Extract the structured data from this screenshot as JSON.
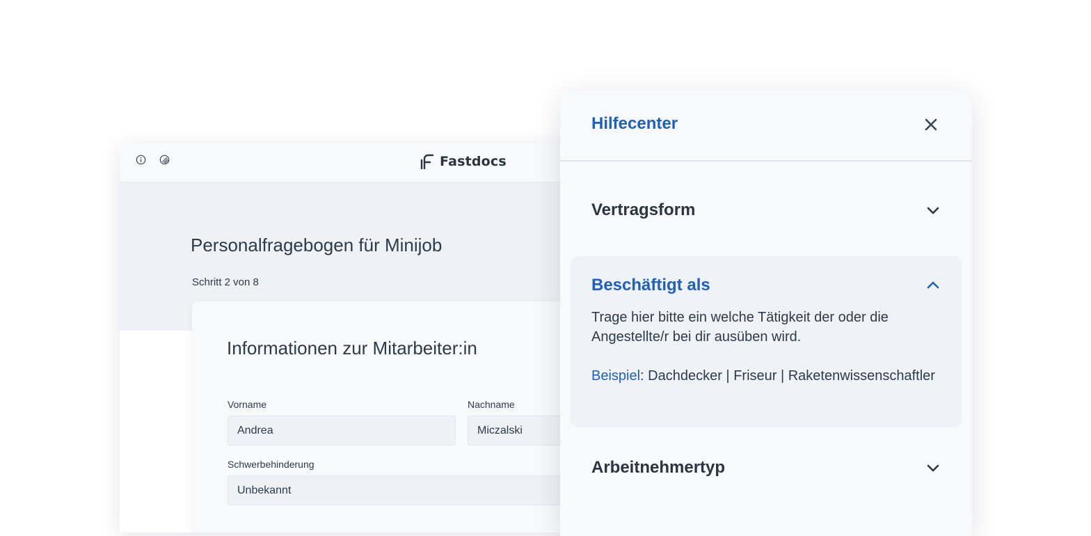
{
  "app": {
    "brand": "Fastdocs",
    "topbar_icons": [
      "info-icon",
      "theme-icon"
    ]
  },
  "form": {
    "page_title": "Personalfragebogen für Minijob",
    "step": "Schritt 2 von 8",
    "section_title": "Informationen zur Mitarbeiter:in",
    "fields": {
      "firstname": {
        "label": "Vorname",
        "value": "Andrea"
      },
      "lastname": {
        "label": "Nachname",
        "value": "Miczalski"
      },
      "disability": {
        "label": "Schwerbehinderung",
        "value": "Unbekannt"
      }
    }
  },
  "help": {
    "title": "Hilfecenter",
    "close_icon": "close-icon",
    "items": [
      {
        "label": "Vertragsform",
        "expanded": false,
        "icon": "chevron-down-icon"
      },
      {
        "label": "Beschäftigt als",
        "expanded": true,
        "icon": "chevron-up-icon",
        "description": "Trage hier bitte ein welche Tätigkeit der oder die Angestellte/r bei dir ausüben wird.",
        "example_label": "Beispiel",
        "example_text": ": Dachdecker | Friseur | Raketenwissenschaftler"
      },
      {
        "label": "Arbeitnehmertyp",
        "expanded": false,
        "icon": "chevron-down-icon"
      }
    ]
  },
  "colors": {
    "accent": "#1f5fbf",
    "text": "#2b3440",
    "panel_bg": "#f8f9fb",
    "expanded_bg": "#eff2f6",
    "hero_bg": "#eef2f6"
  }
}
